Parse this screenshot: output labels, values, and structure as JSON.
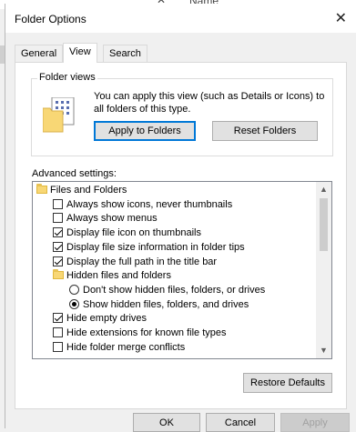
{
  "background": {
    "close_glyph": "✕",
    "column_header": "Name"
  },
  "window": {
    "title": "Folder Options",
    "close_label": "✕"
  },
  "tabs": [
    {
      "label": "General",
      "active": false
    },
    {
      "label": "View",
      "active": true
    },
    {
      "label": "Search",
      "active": false
    }
  ],
  "folder_views": {
    "title": "Folder views",
    "description": "You can apply this view (such as Details or Icons) to all folders of this type.",
    "apply_button": "Apply to Folders",
    "reset_button": "Reset Folders"
  },
  "advanced": {
    "label": "Advanced settings:",
    "items": [
      {
        "type": "folder",
        "label": "Files and Folders",
        "indent": 0
      },
      {
        "type": "checkbox",
        "label": "Always show icons, never thumbnails",
        "checked": false,
        "indent": 1
      },
      {
        "type": "checkbox",
        "label": "Always show menus",
        "checked": false,
        "indent": 1
      },
      {
        "type": "checkbox",
        "label": "Display file icon on thumbnails",
        "checked": true,
        "indent": 1
      },
      {
        "type": "checkbox",
        "label": "Display file size information in folder tips",
        "checked": true,
        "indent": 1
      },
      {
        "type": "checkbox",
        "label": "Display the full path in the title bar",
        "checked": true,
        "indent": 1
      },
      {
        "type": "folder",
        "label": "Hidden files and folders",
        "indent": 1
      },
      {
        "type": "radio",
        "label": "Don't show hidden files, folders, or drives",
        "checked": false,
        "indent": 2
      },
      {
        "type": "radio",
        "label": "Show hidden files, folders, and drives",
        "checked": true,
        "indent": 2
      },
      {
        "type": "checkbox",
        "label": "Hide empty drives",
        "checked": true,
        "indent": 1
      },
      {
        "type": "checkbox",
        "label": "Hide extensions for known file types",
        "checked": false,
        "indent": 1
      },
      {
        "type": "checkbox",
        "label": "Hide folder merge conflicts",
        "checked": false,
        "indent": 1
      }
    ],
    "restore_button": "Restore Defaults"
  },
  "footer": {
    "ok": "OK",
    "cancel": "Cancel",
    "apply": "Apply"
  },
  "colors": {
    "accent": "#0078d7",
    "folder": "#f8d775",
    "panel": "#ffffff",
    "dialog": "#f0f0f0"
  }
}
